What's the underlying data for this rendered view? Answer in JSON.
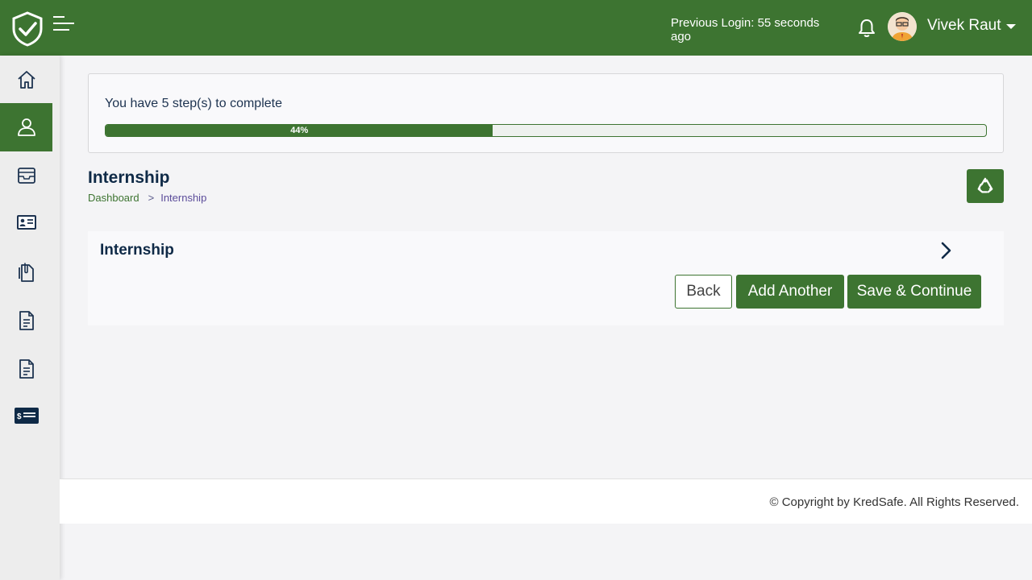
{
  "header": {
    "previous_login": "Previous Login: 55 seconds ago",
    "user_name": "Vivek Raut"
  },
  "sidebar": {
    "items": [
      {
        "icon": "home-icon"
      },
      {
        "icon": "user-icon",
        "active": true
      },
      {
        "icon": "inbox-tray-icon"
      },
      {
        "icon": "id-card-icon"
      },
      {
        "icon": "documents-clip-icon"
      },
      {
        "icon": "document-icon"
      },
      {
        "icon": "document-icon"
      },
      {
        "icon": "payment-card-icon"
      }
    ]
  },
  "progress": {
    "steps_text": "You have 5 step(s) to complete",
    "percent": 44,
    "percent_label": "44%"
  },
  "page": {
    "title": "Internship",
    "breadcrumb": {
      "home": "Dashboard",
      "separator": ">",
      "current": "Internship"
    }
  },
  "section": {
    "title": "Internship",
    "back_label": "Back",
    "add_label": "Add Another",
    "save_label": "Save & Continue"
  },
  "footer": {
    "copyright": "© Copyright by KredSafe. All Rights Reserved."
  },
  "colors": {
    "brand_green": "#3d7431",
    "navy": "#0f2a47"
  }
}
